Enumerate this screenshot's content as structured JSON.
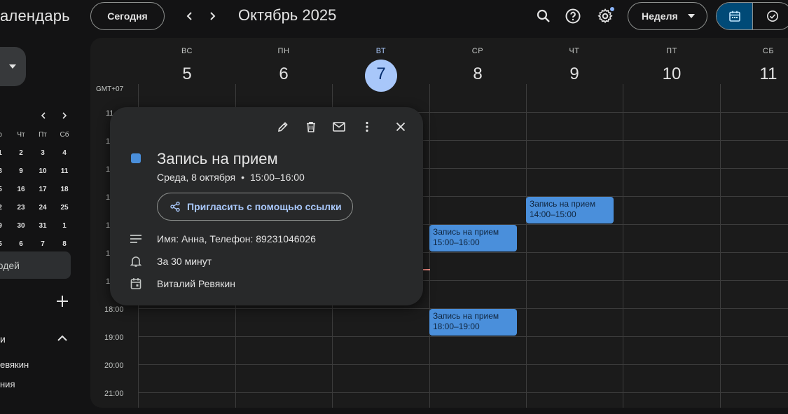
{
  "header": {
    "app_title": "алендарь",
    "today_label": "Сегодня",
    "month_title": "Октябрь 2025",
    "view_label": "Неделя",
    "icons": [
      "search-icon",
      "help-icon",
      "settings-icon",
      "calendar-view-icon",
      "tasks-view-icon"
    ],
    "accent": "#a8c7fa"
  },
  "mini_calendar": {
    "headers": [
      "р",
      "Чт",
      "Пт",
      "Сб"
    ],
    "weeks": [
      [
        "1",
        "2",
        "3",
        "4"
      ],
      [
        "8",
        "9",
        "10",
        "11"
      ],
      [
        "5",
        "16",
        "17",
        "18"
      ],
      [
        "2",
        "23",
        "24",
        "25"
      ],
      [
        "9",
        "30",
        "31",
        "1"
      ],
      [
        "5",
        "6",
        "7",
        "8"
      ]
    ]
  },
  "sidebar": {
    "people_search": "юдей",
    "section_title": "и",
    "calendars": [
      "евякин",
      "ния"
    ]
  },
  "grid": {
    "timezone": "GMT+07",
    "days": [
      {
        "name": "ВС",
        "num": "5"
      },
      {
        "name": "ПН",
        "num": "6"
      },
      {
        "name": "ВТ",
        "num": "7",
        "today": true
      },
      {
        "name": "СР",
        "num": "8"
      },
      {
        "name": "ЧТ",
        "num": "9"
      },
      {
        "name": "ПТ",
        "num": "10"
      },
      {
        "name": "СБ",
        "num": "11"
      }
    ],
    "hour_labels_partial": [
      "11",
      "1",
      "1",
      "1",
      "1",
      "1",
      "1"
    ],
    "hour_labels": [
      "18:00",
      "19:00",
      "20:00",
      "21:00"
    ],
    "events": [
      {
        "title": "Запись на прием",
        "time": "14:00–15:00"
      },
      {
        "title": "Запись на прием",
        "time": "15:00–16:00"
      },
      {
        "title": "Запись на прием",
        "time": "18:00–19:00"
      }
    ],
    "event_color": "#4a8fdb"
  },
  "popup": {
    "title": "Запись на прием",
    "date": "Среда, 8 октября",
    "separator": "•",
    "time": "15:00–16:00",
    "invite_label": "Пригласить с помощью ссылки",
    "description": "Имя: Анна, Телефон: 89231046026",
    "reminder": "За 30 минут",
    "calendar_owner": "Виталий Ревякин"
  }
}
